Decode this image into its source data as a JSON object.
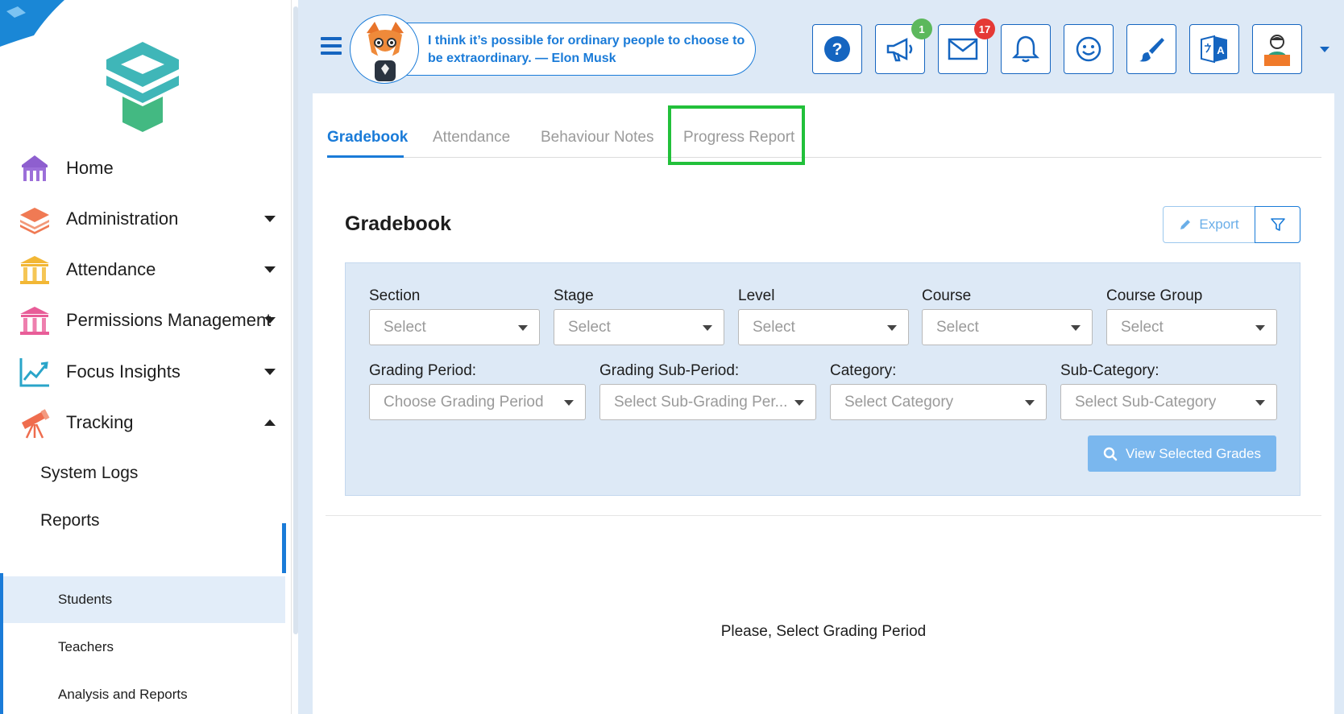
{
  "quote": {
    "text": "I think it’s possible for ordinary people to choose to be extraordinary. — Elon Musk"
  },
  "toolbar": {
    "announcements_badge": "1",
    "messages_badge": "17"
  },
  "sidebar": {
    "items": [
      {
        "label": "Home",
        "icon": "home-icon",
        "color": "#8e5fcf"
      },
      {
        "label": "Administration",
        "icon": "layers-icon",
        "color": "#f07a54"
      },
      {
        "label": "Attendance",
        "icon": "institution-icon",
        "color": "#f2b735"
      },
      {
        "label": "Permissions Management",
        "icon": "institution-icon",
        "color": "#e85d98"
      },
      {
        "label": "Focus Insights",
        "icon": "chart-line-icon",
        "color": "#2aa5c9"
      },
      {
        "label": "Tracking",
        "icon": "telescope-icon",
        "color": "#ef6d4e"
      }
    ],
    "sub_items": [
      {
        "label": "System Logs"
      },
      {
        "label": "Reports"
      }
    ],
    "report_items": [
      {
        "label": "Students",
        "active": true
      },
      {
        "label": "Teachers"
      },
      {
        "label": "Analysis and Reports"
      }
    ]
  },
  "tabs": [
    {
      "label": "Gradebook",
      "active": true
    },
    {
      "label": "Attendance"
    },
    {
      "label": "Behaviour Notes"
    },
    {
      "label": "Progress Report"
    }
  ],
  "gradebook": {
    "title": "Gradebook",
    "export_label": "Export",
    "filters_row1": [
      {
        "label": "Section",
        "value": "Select"
      },
      {
        "label": "Stage",
        "value": "Select"
      },
      {
        "label": "Level",
        "value": "Select"
      },
      {
        "label": "Course",
        "value": "Select"
      },
      {
        "label": "Course Group",
        "value": "Select"
      }
    ],
    "filters_row2": [
      {
        "label": "Grading Period:",
        "value": "Choose Grading Period"
      },
      {
        "label": "Grading Sub-Period:",
        "value": "Select Sub-Grading Per..."
      },
      {
        "label": "Category:",
        "value": "Select Category"
      },
      {
        "label": "Sub-Category:",
        "value": "Select Sub-Category"
      }
    ],
    "view_button": "View Selected Grades",
    "empty_message": "Please, Select Grading Period"
  },
  "colors": {
    "accent": "#1a7bd8",
    "highlight": "#22c03a",
    "panel_bg": "#dde9f6"
  }
}
